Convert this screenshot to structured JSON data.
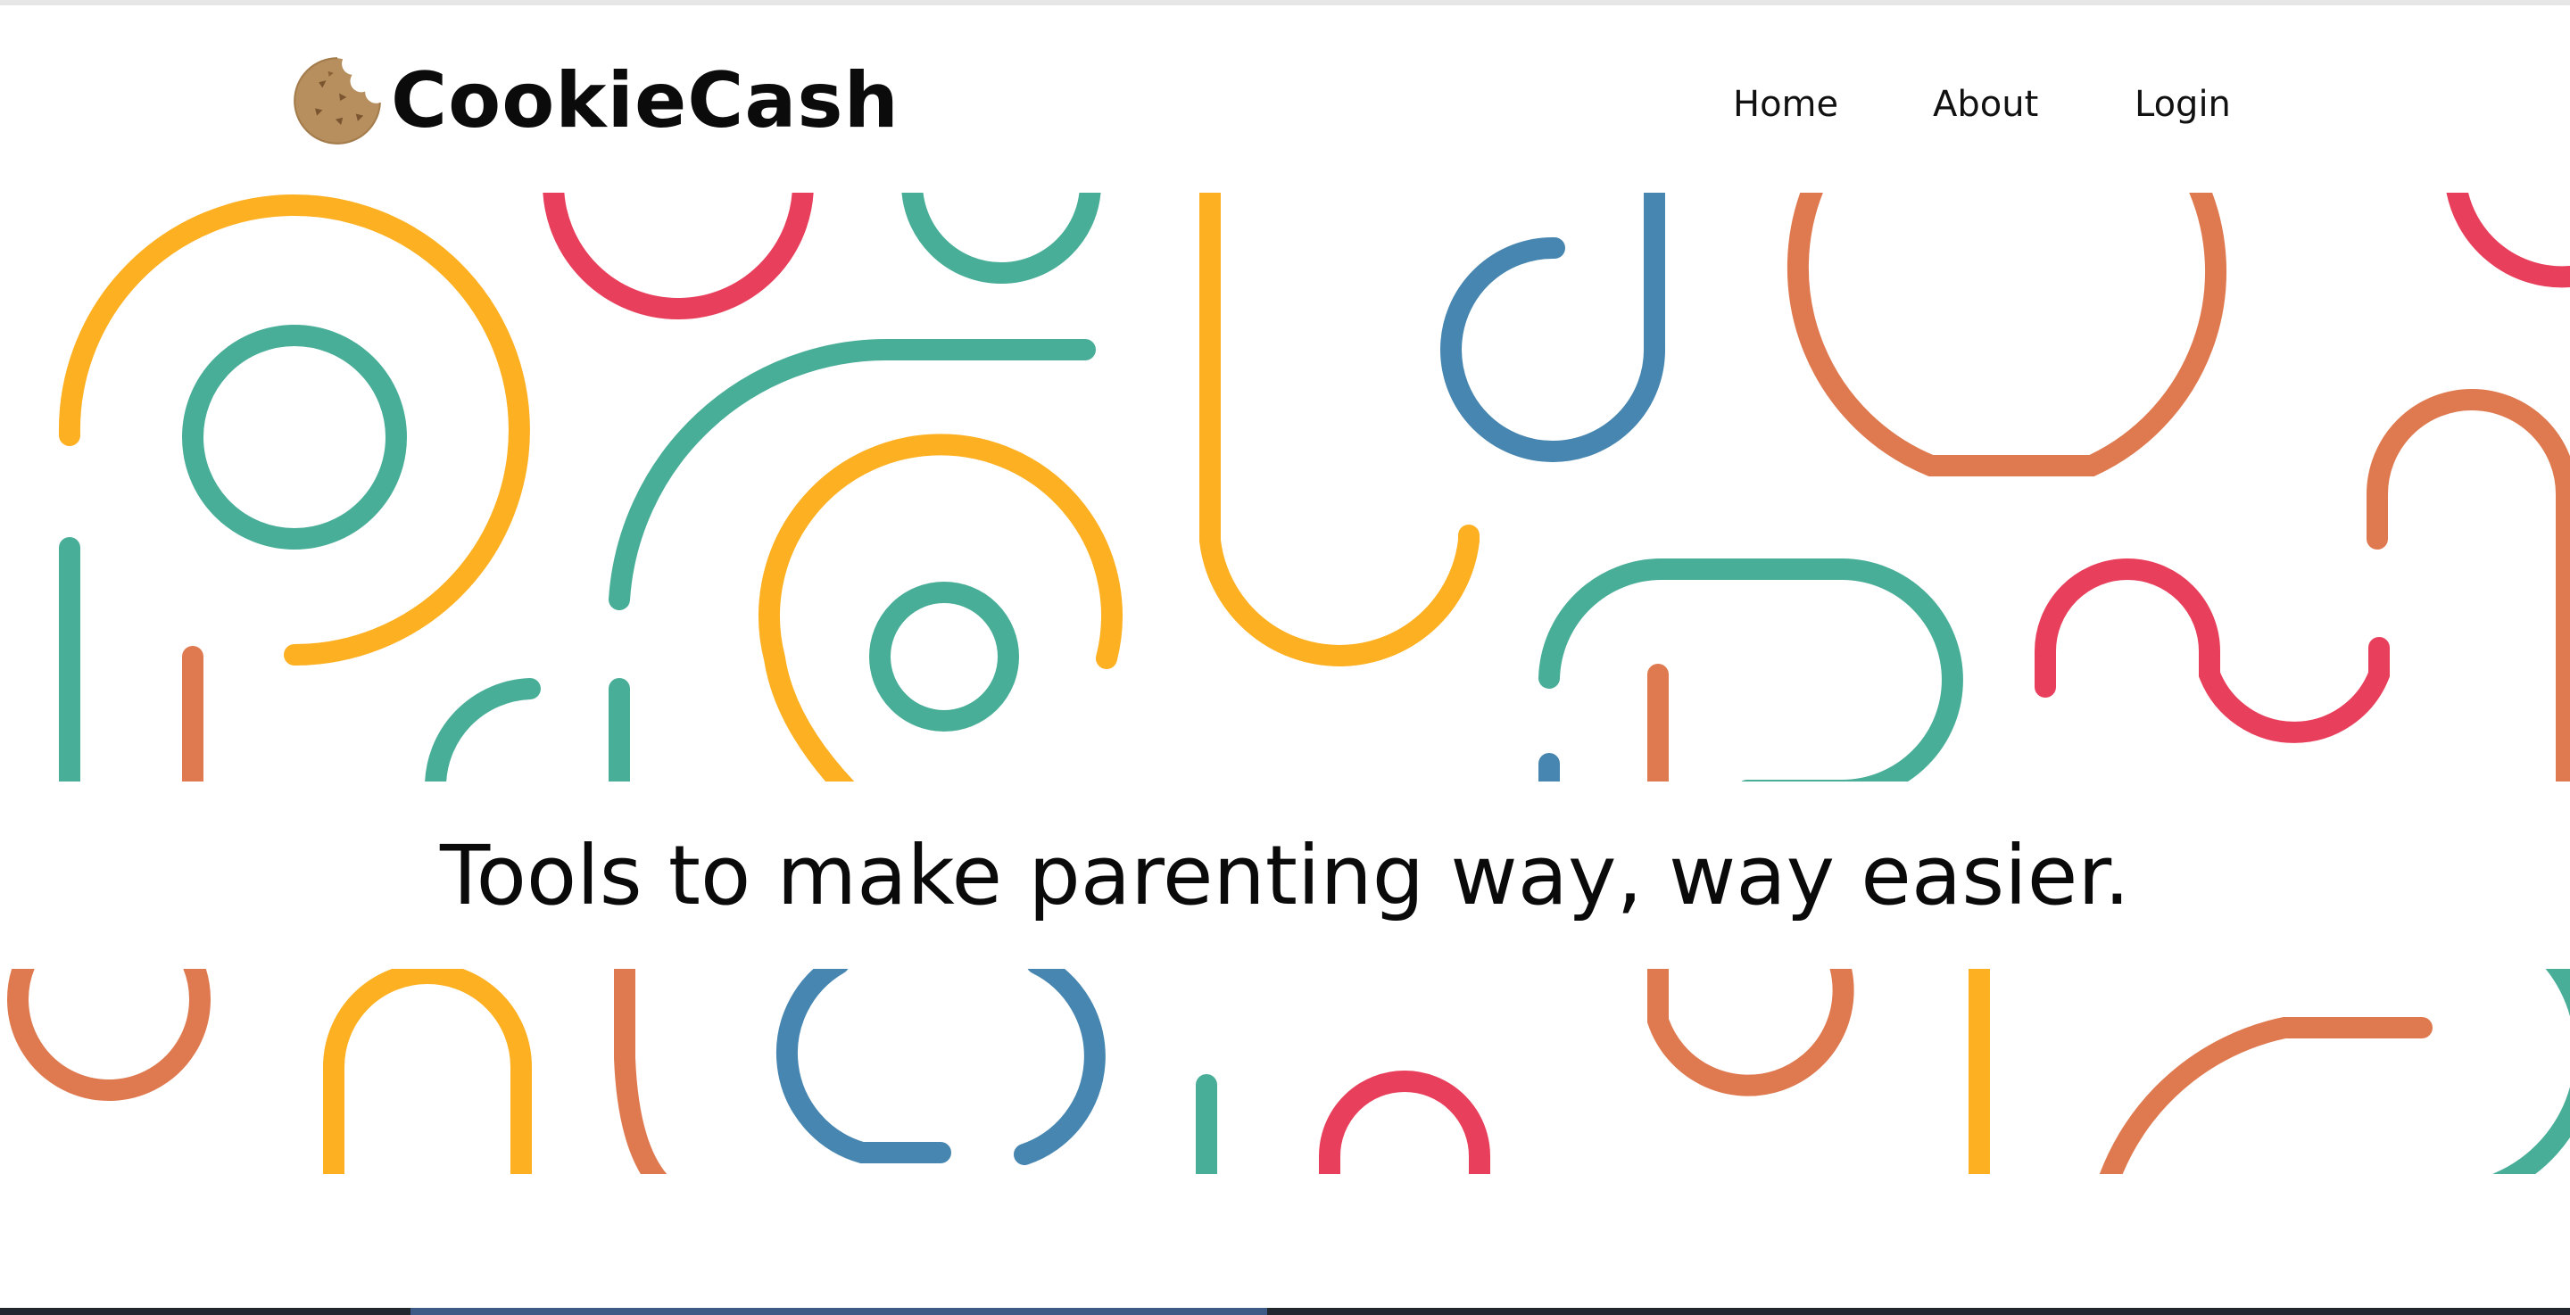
{
  "brand": {
    "name": "CookieCash",
    "logo_icon": "cookie-icon"
  },
  "nav": {
    "items": [
      {
        "label": "Home"
      },
      {
        "label": "About"
      },
      {
        "label": "Login"
      }
    ]
  },
  "hero": {
    "tagline": "Tools to make parenting way, way easier."
  },
  "colors": {
    "yellow": "#fdb022",
    "teal": "#48ae98",
    "red": "#e8405c",
    "orange": "#df7a50",
    "blue": "#4686b0",
    "cookie": "#b78f5e",
    "text": "#0b0b0b"
  }
}
